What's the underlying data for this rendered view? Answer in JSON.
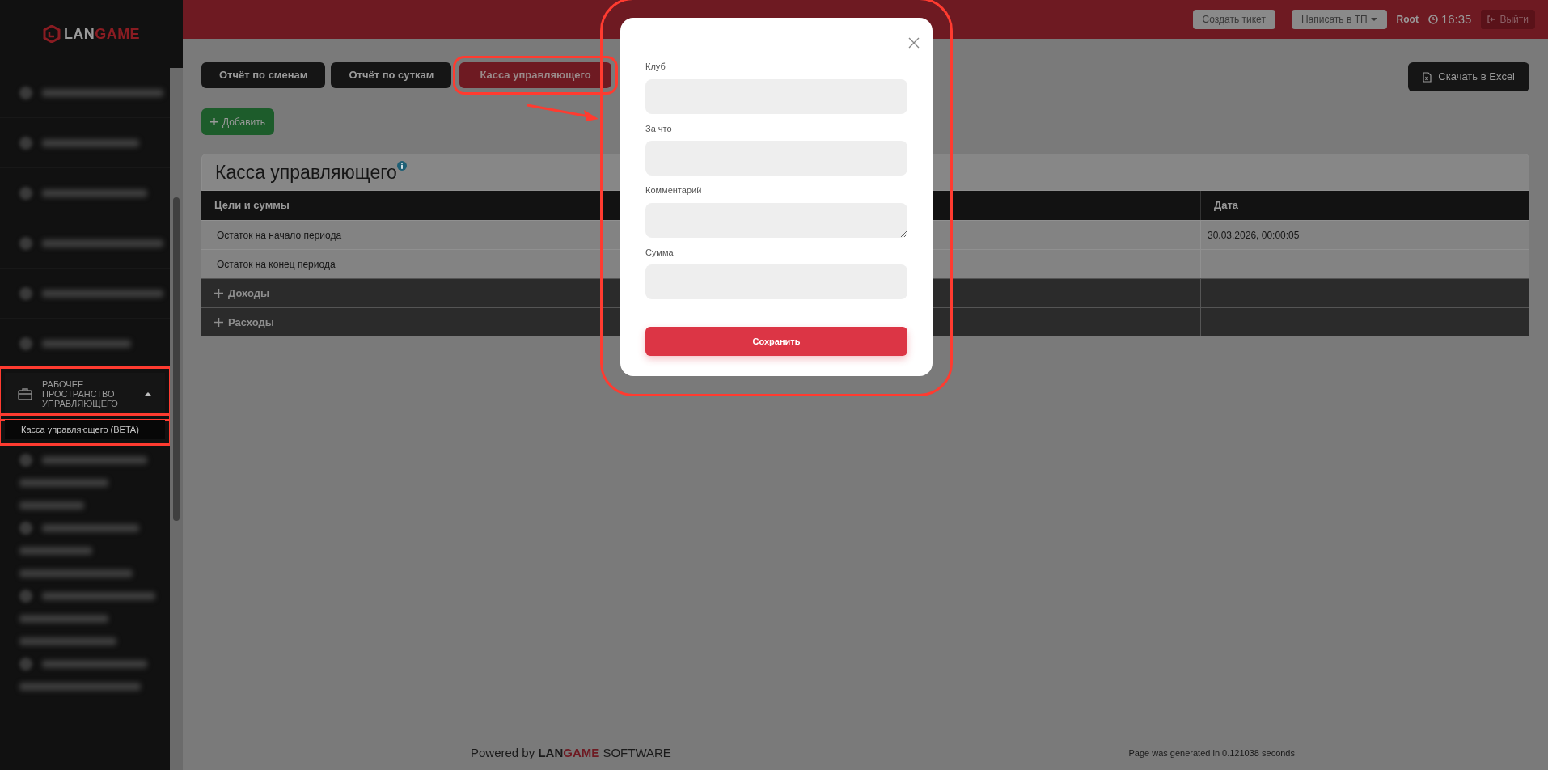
{
  "header": {
    "create_ticket": "Создать тикет",
    "write_support": "Написать в ТП",
    "user": "Root",
    "time": "16:35",
    "logout": "Выйти"
  },
  "sidebar": {
    "logo": {
      "part1": "LAN",
      "part2": "GAME"
    },
    "section": {
      "label": "РАБОЧЕЕ ПРОСТРАНСТВО УПРАВЛЯЮЩЕГО",
      "expanded": true,
      "highlighted": true,
      "children": [
        {
          "label": "Касса управляющего (BETA)",
          "selected": true,
          "highlighted": true
        }
      ]
    }
  },
  "tabs": [
    {
      "label": "Отчёт по сменам",
      "selected": false,
      "highlighted": false
    },
    {
      "label": "Отчёт по суткам",
      "selected": false,
      "highlighted": false
    },
    {
      "label": "Касса управляющего",
      "selected": true,
      "highlighted": true
    }
  ],
  "add_button": "Добавить",
  "export_button": "Скачать в Excel",
  "panel": {
    "title": "Касса управляющего",
    "columns": [
      "Цели и суммы",
      "Дата"
    ],
    "rows": [
      {
        "kind": "plain",
        "label": "Остаток на начало периода",
        "date": "30.03.2026, 00:00:05"
      },
      {
        "kind": "plain",
        "label": "Остаток на конец периода"
      },
      {
        "kind": "group",
        "label": "Доходы",
        "expanded": false
      },
      {
        "kind": "group",
        "label": "Расходы",
        "expanded": false
      }
    ]
  },
  "footer": {
    "powered_prefix": "Powered by",
    "brand_part1": "LAN",
    "brand_part2": "GAME",
    "powered_suffix": "SOFTWARE",
    "generated": "Page was generated in 0.121038 seconds"
  },
  "modal": {
    "highlighted": true,
    "fields": [
      {
        "label": "Клуб",
        "kind": "input"
      },
      {
        "label": "За что",
        "kind": "input"
      },
      {
        "label": "Комментарий",
        "kind": "textarea"
      },
      {
        "label": "Сумма",
        "kind": "input"
      }
    ],
    "save": "Сохранить"
  }
}
